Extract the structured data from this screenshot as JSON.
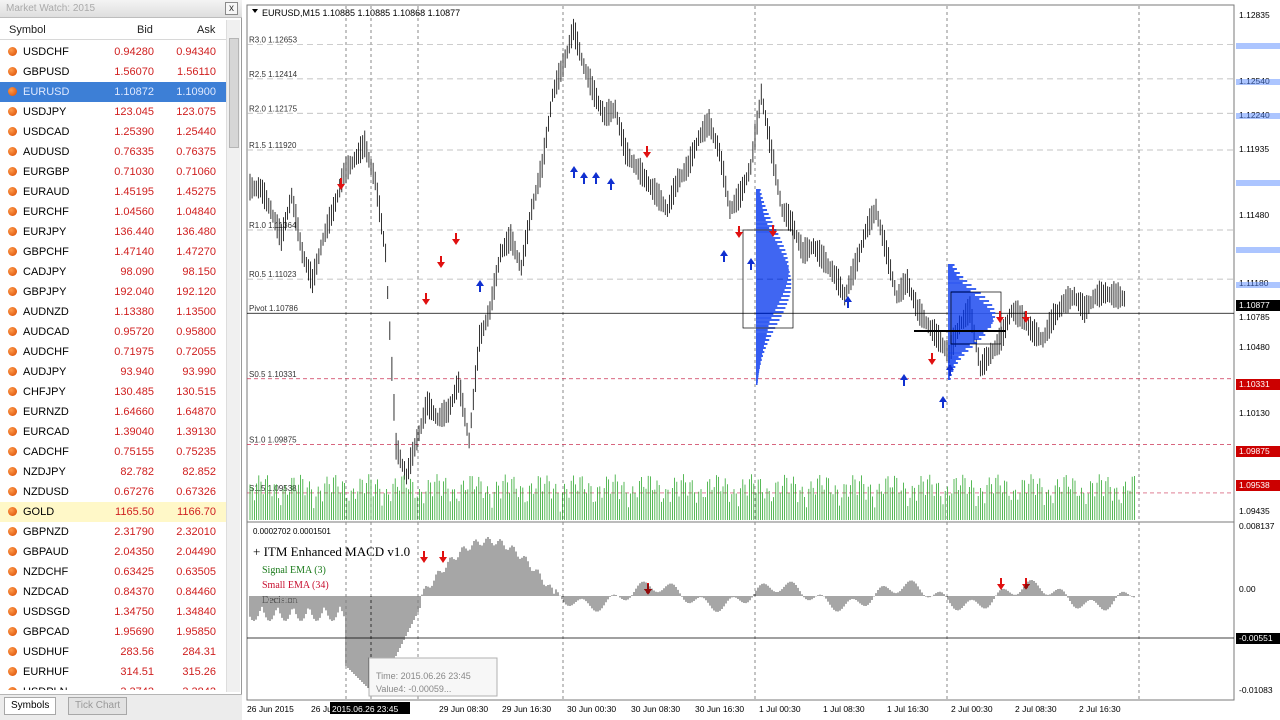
{
  "market_watch": {
    "title": "Market Watch: 2015",
    "close_label": "x",
    "columns": {
      "symbol": "Symbol",
      "bid": "Bid",
      "ask": "Ask"
    },
    "rows": [
      {
        "symbol": "USDCHF",
        "bid": "0.94280",
        "ask": "0.94340"
      },
      {
        "symbol": "GBPUSD",
        "bid": "1.56070",
        "ask": "1.56110"
      },
      {
        "symbol": "EURUSD",
        "bid": "1.10872",
        "ask": "1.10900",
        "selected": true
      },
      {
        "symbol": "USDJPY",
        "bid": "123.045",
        "ask": "123.075"
      },
      {
        "symbol": "USDCAD",
        "bid": "1.25390",
        "ask": "1.25440"
      },
      {
        "symbol": "AUDUSD",
        "bid": "0.76335",
        "ask": "0.76375"
      },
      {
        "symbol": "EURGBP",
        "bid": "0.71030",
        "ask": "0.71060"
      },
      {
        "symbol": "EURAUD",
        "bid": "1.45195",
        "ask": "1.45275"
      },
      {
        "symbol": "EURCHF",
        "bid": "1.04560",
        "ask": "1.04840"
      },
      {
        "symbol": "EURJPY",
        "bid": "136.440",
        "ask": "136.480"
      },
      {
        "symbol": "GBPCHF",
        "bid": "1.47140",
        "ask": "1.47270"
      },
      {
        "symbol": "CADJPY",
        "bid": "98.090",
        "ask": "98.150"
      },
      {
        "symbol": "GBPJPY",
        "bid": "192.040",
        "ask": "192.120"
      },
      {
        "symbol": "AUDNZD",
        "bid": "1.13380",
        "ask": "1.13500"
      },
      {
        "symbol": "AUDCAD",
        "bid": "0.95720",
        "ask": "0.95800"
      },
      {
        "symbol": "AUDCHF",
        "bid": "0.71975",
        "ask": "0.72055"
      },
      {
        "symbol": "AUDJPY",
        "bid": "93.940",
        "ask": "93.990"
      },
      {
        "symbol": "CHFJPY",
        "bid": "130.485",
        "ask": "130.515"
      },
      {
        "symbol": "EURNZD",
        "bid": "1.64660",
        "ask": "1.64870"
      },
      {
        "symbol": "EURCAD",
        "bid": "1.39040",
        "ask": "1.39130"
      },
      {
        "symbol": "CADCHF",
        "bid": "0.75155",
        "ask": "0.75235"
      },
      {
        "symbol": "NZDJPY",
        "bid": "82.782",
        "ask": "82.852"
      },
      {
        "symbol": "NZDUSD",
        "bid": "0.67276",
        "ask": "0.67326"
      },
      {
        "symbol": "GOLD",
        "bid": "1165.50",
        "ask": "1166.70",
        "highlight": true
      },
      {
        "symbol": "GBPNZD",
        "bid": "2.31790",
        "ask": "2.32010"
      },
      {
        "symbol": "GBPAUD",
        "bid": "2.04350",
        "ask": "2.04490"
      },
      {
        "symbol": "NZDCHF",
        "bid": "0.63425",
        "ask": "0.63505"
      },
      {
        "symbol": "NZDCAD",
        "bid": "0.84370",
        "ask": "0.84460"
      },
      {
        "symbol": "USDSGD",
        "bid": "1.34750",
        "ask": "1.34840"
      },
      {
        "symbol": "GBPCAD",
        "bid": "1.95690",
        "ask": "1.95850"
      },
      {
        "symbol": "USDHUF",
        "bid": "283.56",
        "ask": "284.31"
      },
      {
        "symbol": "EURHUF",
        "bid": "314.51",
        "ask": "315.26"
      },
      {
        "symbol": "USDPLN",
        "bid": "3.3743",
        "ask": "3.3842"
      }
    ],
    "tabs": [
      "Symbols",
      "Tick Chart"
    ]
  },
  "chart": {
    "header": "EURUSD,M15  1.10885 1.10885 1.10868 1.10877",
    "indicator_values": "0.0002702 0.0001501",
    "indicator_name": "+ ITM Enhanced MACD v1.0",
    "legend": [
      "Signal EMA (3)",
      "Small EMA (34)",
      "Decision"
    ],
    "tooltip_time": "Time: 2015.06.26 23:45",
    "tooltip_value": "Value4: -0.00059..."
  },
  "chart_data": {
    "type": "bar",
    "title": "EURUSD,M15",
    "price_axis_labels": [
      "1.12835",
      "1.12540",
      "1.12240",
      "1.11935",
      "1.11480",
      "1.11180",
      "1.10877",
      "1.10785",
      "1.10480",
      "1.10331",
      "1.10130",
      "1.09875",
      "1.09538",
      "1.09435"
    ],
    "price_axis_highlights": [
      {
        "label": "1.10877",
        "color": "#000000"
      },
      {
        "label": "1.10331",
        "color": "#cc0000"
      },
      {
        "label": "1.09875",
        "color": "#cc0000"
      },
      {
        "label": "1.09538",
        "color": "#cc0000"
      }
    ],
    "pivot_levels": [
      {
        "label": "R3.0  1.12653",
        "value": 1.12653
      },
      {
        "label": "R2.5  1.12414",
        "value": 1.12414
      },
      {
        "label": "R2.0  1.12175",
        "value": 1.12175
      },
      {
        "label": "R1.5  1.11920",
        "value": 1.1192
      },
      {
        "label": "R1.0  1.11364",
        "value": 1.11364
      },
      {
        "label": "R0.5  1.11023",
        "value": 1.11023
      },
      {
        "label": "Pivot  1.10786",
        "value": 1.10786
      },
      {
        "label": "S0.5  1.10331",
        "value": 1.10331
      },
      {
        "label": "S1.0  1.09875",
        "value": 1.09875
      },
      {
        "label": "S1.5  1.09538",
        "value": 1.09538
      }
    ],
    "ylim": [
      1.0935,
      1.1292
    ],
    "time_axis_labels": [
      "26 Jun 2015",
      "26 Jun",
      "2015.06.26 23:45",
      "29 Jun 08:30",
      "29 Jun 16:30",
      "30 Jun 00:30",
      "30 Jun 08:30",
      "30 Jun 16:30",
      "1 Jul 00:30",
      "1 Jul 08:30",
      "1 Jul 16:30",
      "2 Jul 00:30",
      "2 Jul 08:30",
      "2 Jul 16:30"
    ],
    "indicator_axis_labels": [
      "0.008137",
      "0.00",
      "-0.00551",
      "-0.01083"
    ],
    "price_path": [
      1.1165,
      1.115,
      1.113,
      1.116,
      1.112,
      1.11,
      1.113,
      1.115,
      1.1175,
      1.1185,
      1.1195,
      1.117,
      1.112,
      1.0985,
      1.0965,
      1.099,
      1.1015,
      1.1005,
      1.101,
      1.103,
      1.099,
      1.106,
      1.108,
      1.112,
      1.113,
      1.111,
      1.115,
      1.118,
      1.123,
      1.125,
      1.1275,
      1.125,
      1.123,
      1.1215,
      1.122,
      1.119,
      1.118,
      1.117,
      1.116,
      1.115,
      1.117,
      1.118,
      1.12,
      1.121,
      1.119,
      1.115,
      1.116,
      1.118,
      1.123,
      1.119,
      1.115,
      1.114,
      1.112,
      1.1125,
      1.1115,
      1.1105,
      1.109,
      1.111,
      1.1135,
      1.115,
      1.112,
      1.109,
      1.11,
      1.108,
      1.107,
      1.106,
      1.105,
      1.107,
      1.108,
      1.104,
      1.105,
      1.106,
      1.108,
      1.1075,
      1.1065,
      1.106,
      1.1075,
      1.1085,
      1.109,
      1.108,
      1.109,
      1.1092,
      1.109,
      1.1088
    ]
  }
}
